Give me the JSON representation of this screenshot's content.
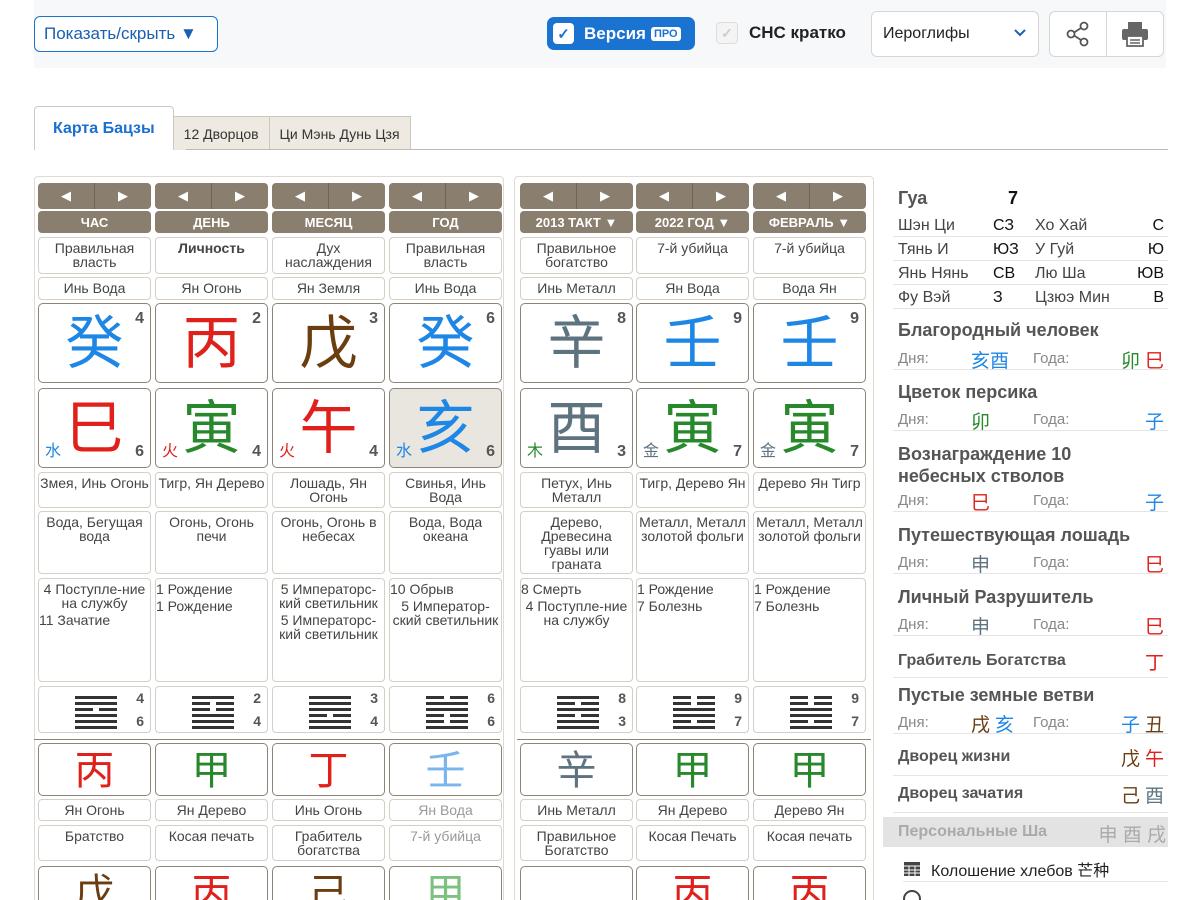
{
  "toolbar": {
    "showhide": "Показать/скрыть ▼",
    "version": "Версия",
    "pro": "ПРО",
    "short": "СНС кратко",
    "select": "Иероглифы"
  },
  "tabs": [
    "Карта Бацзы",
    "12 Дворцов",
    "Ци Мэнь Дунь Цзя"
  ],
  "colors": {
    "wood": "#27892b",
    "fire": "#e0201a",
    "earth": "#6b3e12",
    "metal": "#5e7380",
    "water": "#1e87e5"
  },
  "pillars": [
    {
      "head": "ЧАС",
      "star": "Правильная власть",
      "stem_name": "Инь Вода",
      "stem": "癸",
      "stem_num": "4",
      "branch": "巳",
      "branch_el": "水",
      "branch_num": "6",
      "animal": "Змея, Инь Огонь",
      "nayin": "Вода, Бегущая вода",
      "life": [
        "4 Поступле-ние на службу",
        "11 Зачатие"
      ],
      "hex_a": "4",
      "hex_b": "6",
      "h_stem": "丙",
      "h_name": "Ян Огонь",
      "h_star": "Братство",
      "bot": "戊"
    },
    {
      "head": "ДЕНЬ",
      "star": "Личность",
      "stem_name": "Ян Огонь",
      "stem": "丙",
      "stem_num": "2",
      "branch": "寅",
      "branch_el": "火",
      "branch_num": "4",
      "animal": "Тигр, Ян Дерево",
      "nayin": "Огонь, Огонь печи",
      "life": [
        "1 Рождение",
        "1 Рождение"
      ],
      "hex_a": "2",
      "hex_b": "4",
      "h_stem": "甲",
      "h_name": "Ян Дерево",
      "h_star": "Косая печать",
      "bot": "丙"
    },
    {
      "head": "МЕСЯЦ",
      "star": "Дух наслаждения",
      "stem_name": "Ян Земля",
      "stem": "戊",
      "stem_num": "3",
      "branch": "午",
      "branch_el": "火",
      "branch_num": "4",
      "animal": "Лошадь, Ян Огонь",
      "nayin": "Огонь, Огонь в небесах",
      "life": [
        "5 Императорс-кий светильник",
        "5 Императорс-кий светильник"
      ],
      "hex_a": "3",
      "hex_b": "4",
      "h_stem": "丁",
      "h_name": "Инь Огонь",
      "h_star": "Грабитель богатства",
      "bot": "己"
    },
    {
      "head": "ГОД",
      "star": "Правильная власть",
      "stem_name": "Инь Вода",
      "stem": "癸",
      "stem_num": "6",
      "branch": "亥",
      "branch_el": "水",
      "branch_num": "6",
      "animal": "Свинья, Инь Вода",
      "nayin": "Вода, Вода океана",
      "life": [
        "10 Обрыв",
        "5 Император-ский светильник"
      ],
      "hex_a": "6",
      "hex_b": "6",
      "h_stem": "壬",
      "h_name": "Ян Вода",
      "h_star": "7-й убийца",
      "bot": "甲"
    }
  ],
  "lucks": [
    {
      "head": "2013 ТАКТ ▼",
      "star": "Правильное богатство",
      "stem_name": "Инь Металл",
      "stem": "辛",
      "stem_num": "8",
      "branch": "酉",
      "branch_el": "木",
      "branch_num": "3",
      "animal": "Петух, Инь Металл",
      "nayin": "Дерево, Древесина гуавы или граната",
      "life": [
        "8 Смерть",
        "4 Поступле-ние на службу"
      ],
      "hex_a": "8",
      "hex_b": "3",
      "h_stem": "辛",
      "h_name": "Инь Металл",
      "h_star": "Правильное Богатство",
      "bot": ""
    },
    {
      "head": "2022 ГОД ▼",
      "star": "7-й убийца",
      "stem_name": "Ян Вода",
      "stem": "壬",
      "stem_num": "9",
      "branch": "寅",
      "branch_el": "金",
      "branch_num": "7",
      "animal": "Тигр, Дерево Ян",
      "nayin": "Металл, Металл золотой фольги",
      "life": [
        "1 Рождение",
        "7 Болезнь"
      ],
      "hex_a": "9",
      "hex_b": "7",
      "h_stem": "甲",
      "h_name": "Ян Дерево",
      "h_star": "Косая Печать",
      "bot": "丙"
    },
    {
      "head": "ФЕВРАЛЬ ▼",
      "star": "7-й убийца",
      "stem_name": "Вода Ян",
      "stem": "壬",
      "stem_num": "9",
      "branch": "寅",
      "branch_el": "金",
      "branch_num": "7",
      "animal": "Дерево Ян Тигр",
      "nayin": "Металл, Металл золотой фольги",
      "life": [
        "1 Рождение",
        "7 Болезнь"
      ],
      "hex_a": "9",
      "hex_b": "7",
      "h_stem": "甲",
      "h_name": "Дерево Ян",
      "h_star": "Косая печать",
      "bot": "丙"
    }
  ],
  "side": {
    "gua_label": "Гуа",
    "gua_val": "7",
    "dirs": [
      [
        "Шэн Ци",
        "СЗ",
        "Хо Хай",
        "С"
      ],
      [
        "Тянь И",
        "ЮЗ",
        "У Гуй",
        "Ю"
      ],
      [
        "Янь Нянь",
        "СВ",
        "Лю Ша",
        "ЮВ"
      ],
      [
        "Фу Вэй",
        "З",
        "Цзюэ Мин",
        "В"
      ]
    ],
    "day": "Дня:",
    "year": "Года:",
    "noble": "Благородный человек",
    "noble_d": "亥酉",
    "noble_y1": "卯",
    "noble_y2": "巳",
    "peach": "Цветок персика",
    "peach_d": "卯",
    "peach_y": "子",
    "reward": "Вознаграждение 10 небесных стволов",
    "reward_d": "巳",
    "reward_y": "子",
    "horse": "Путешествующая лошадь",
    "horse_d": "申",
    "horse_y": "巳",
    "destroyer": "Личный Разрушитель",
    "destroyer_d": "申",
    "destroyer_y": "巳",
    "robber": "Грабитель Богатства",
    "robber_v": "丁",
    "empty": "Пустые земные ветви",
    "empty_d1": "戌",
    "empty_d2": "亥",
    "empty_y1": "子",
    "empty_y2": "丑",
    "life_palace": "Дворец жизни",
    "lp1": "戊",
    "lp2": "午",
    "conc_palace": "Дворец зачатия",
    "cp1": "己",
    "cp2": "酉",
    "personal_sha": "Персональные Ша",
    "ps": "申 酉 戌",
    "solar": "Колошение хлебов 芒种"
  }
}
